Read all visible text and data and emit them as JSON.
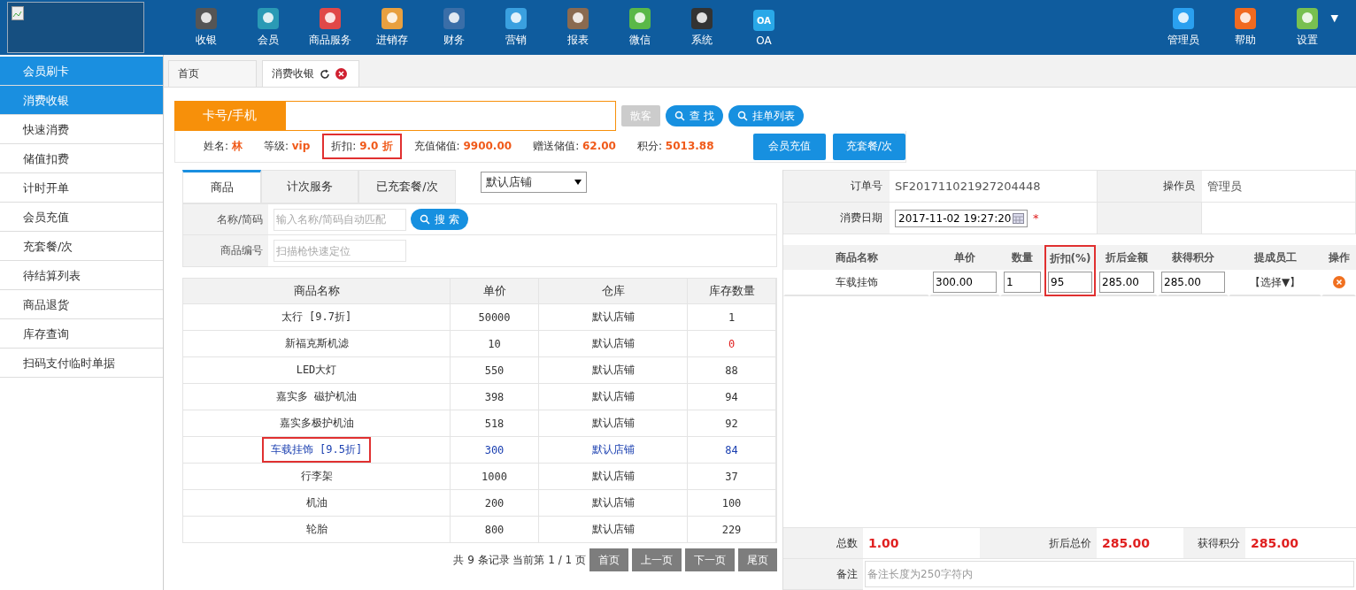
{
  "header": {
    "nav": [
      {
        "label": "收银"
      },
      {
        "label": "会员"
      },
      {
        "label": "商品服务"
      },
      {
        "label": "进销存"
      },
      {
        "label": "财务"
      },
      {
        "label": "营销"
      },
      {
        "label": "报表"
      },
      {
        "label": "微信"
      },
      {
        "label": "系统"
      },
      {
        "label": "OA",
        "icon_text": "OA"
      }
    ],
    "right": [
      {
        "label": "管理员"
      },
      {
        "label": "帮助"
      },
      {
        "label": "设置",
        "dropdown": "▼"
      }
    ]
  },
  "sidebar": {
    "items": [
      {
        "label": "会员刷卡",
        "selected": true
      },
      {
        "label": "消费收银",
        "selected": true
      },
      {
        "label": "快速消费",
        "selected": false
      },
      {
        "label": "储值扣费",
        "selected": false
      },
      {
        "label": "计时开单",
        "selected": false
      },
      {
        "label": "会员充值",
        "selected": false
      },
      {
        "label": "充套餐/次",
        "selected": false
      },
      {
        "label": "待结算列表",
        "selected": false
      },
      {
        "label": "商品退货",
        "selected": false
      },
      {
        "label": "库存查询",
        "selected": false
      },
      {
        "label": "扫码支付临时单据",
        "selected": false
      }
    ]
  },
  "page_tabs": [
    {
      "label": "首页",
      "selected": false,
      "closable": false
    },
    {
      "label": "消费收银",
      "selected": true,
      "closable": true
    }
  ],
  "card_search": {
    "label": "卡号/手机",
    "buttons": [
      {
        "label": "散客",
        "disabled": true,
        "icon": false
      },
      {
        "label": "查 找",
        "disabled": false,
        "icon": true
      },
      {
        "label": "挂单列表",
        "disabled": false,
        "icon": true
      }
    ]
  },
  "member_info": {
    "fields": [
      {
        "label": "姓名:",
        "value": "林",
        "highlighted": false
      },
      {
        "label": "等级:",
        "value": "vip",
        "highlighted": false
      },
      {
        "label": "折扣:",
        "value": "9.0 折",
        "highlighted": true
      },
      {
        "label": "充值储值:",
        "value": "9900.00",
        "highlighted": false
      },
      {
        "label": "赠送储值:",
        "value": "62.00",
        "highlighted": false
      },
      {
        "label": "积分:",
        "value": "5013.88",
        "highlighted": false
      }
    ],
    "buttons": [
      "会员充值",
      "充套餐/次"
    ]
  },
  "product_panel": {
    "tabs": [
      {
        "label": "商品",
        "selected": true
      },
      {
        "label": "计次服务",
        "selected": false
      },
      {
        "label": "已充套餐/次",
        "selected": false
      }
    ],
    "store_select": {
      "value": "默认店铺"
    },
    "filters": [
      {
        "label": "名称/简码",
        "placeholder": "输入名称/简码自动匹配",
        "button": "搜 索"
      },
      {
        "label": "商品编号",
        "placeholder": "扫描枪快速定位"
      }
    ],
    "table": {
      "columns": [
        "商品名称",
        "单价",
        "仓库",
        "库存数量"
      ],
      "rows": [
        {
          "name": "太行",
          "discount": "[9.7折]",
          "price": "50000",
          "warehouse": "默认店铺",
          "stock": "1",
          "stock_alert": false,
          "selected": false,
          "highlighted": false
        },
        {
          "name": "新福克斯机滤",
          "price": "10",
          "warehouse": "默认店铺",
          "stock": "0",
          "stock_alert": true,
          "selected": false,
          "highlighted": false
        },
        {
          "name": "LED大灯",
          "price": "550",
          "warehouse": "默认店铺",
          "stock": "88",
          "stock_alert": false,
          "selected": false,
          "highlighted": false
        },
        {
          "name": "嘉实多 磁护机油",
          "price": "398",
          "warehouse": "默认店铺",
          "stock": "94",
          "stock_alert": false,
          "selected": false,
          "highlighted": false
        },
        {
          "name": "嘉实多极护机油",
          "price": "518",
          "warehouse": "默认店铺",
          "stock": "92",
          "stock_alert": false,
          "selected": false,
          "highlighted": false
        },
        {
          "name": "车载挂饰",
          "discount": "[9.5折]",
          "price": "300",
          "warehouse": "默认店铺",
          "stock": "84",
          "stock_alert": false,
          "selected": true,
          "highlighted": true
        },
        {
          "name": "行李架",
          "price": "1000",
          "warehouse": "默认店铺",
          "stock": "37",
          "stock_alert": false,
          "selected": false,
          "highlighted": false
        },
        {
          "name": "机油",
          "price": "200",
          "warehouse": "默认店铺",
          "stock": "100",
          "stock_alert": false,
          "selected": false,
          "highlighted": false
        },
        {
          "name": "轮胎",
          "price": "800",
          "warehouse": "默认店铺",
          "stock": "229",
          "stock_alert": false,
          "selected": false,
          "highlighted": false
        }
      ]
    },
    "pagination": {
      "summary": "共 9 条记录 当前第 1 / 1 页",
      "buttons": [
        "首页",
        "上一页",
        "下一页",
        "尾页"
      ]
    }
  },
  "order_panel": {
    "order_no_label": "订单号",
    "order_no": "SF201711021927204448",
    "operator_label": "操作员",
    "operator": "管理员",
    "date_label": "消费日期",
    "date": "2017-11-02 19:27:20",
    "required_mark": "*",
    "line_columns": [
      {
        "label": "商品名称",
        "highlighted": false
      },
      {
        "label": "单价",
        "highlighted": false
      },
      {
        "label": "数量",
        "highlighted": false
      },
      {
        "label": "折扣(%)",
        "highlighted": true
      },
      {
        "label": "折后金额",
        "highlighted": false
      },
      {
        "label": "获得积分",
        "highlighted": false
      },
      {
        "label": "提成员工",
        "highlighted": false
      },
      {
        "label": "操作",
        "highlighted": false
      }
    ],
    "lines": [
      {
        "name": "车载挂饰",
        "price": "300.00",
        "qty": "1",
        "discount": "95",
        "amount": "285.00",
        "points": "285.00",
        "staff": "【选择▼】"
      }
    ],
    "totals": [
      {
        "label": "总数",
        "value": "1.00"
      },
      {
        "label": "折后总价",
        "value": "285.00"
      },
      {
        "label": "获得积分",
        "value": "285.00"
      }
    ],
    "remark_label": "备注",
    "remark_placeholder": "备注长度为250字符内"
  }
}
